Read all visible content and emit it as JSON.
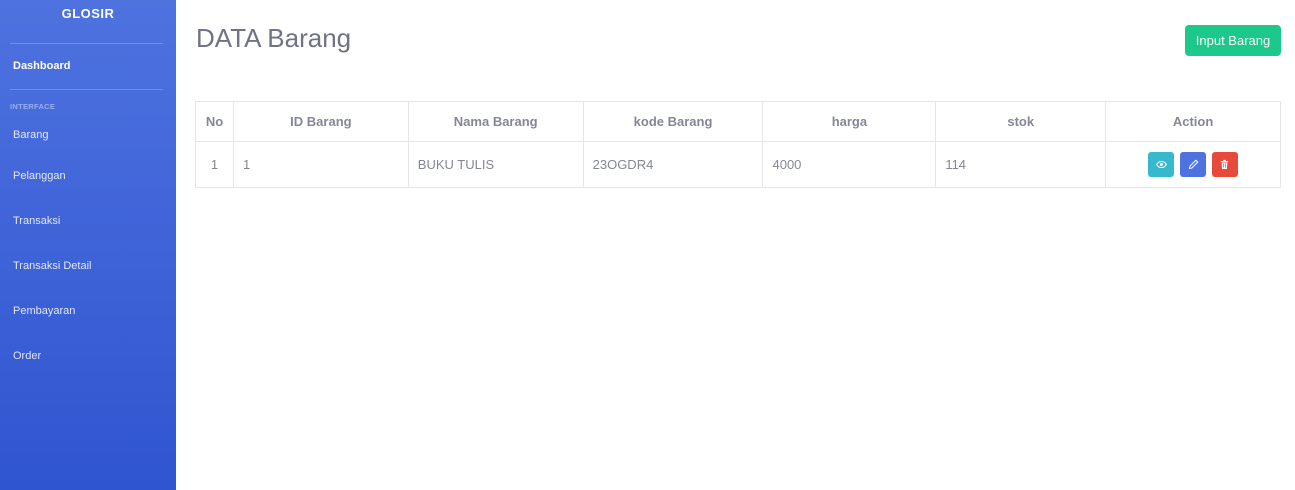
{
  "sidebar": {
    "brand": "GLOSIR",
    "dashboard": "Dashboard",
    "heading": "INTERFACE",
    "items": [
      {
        "label": "Barang"
      },
      {
        "label": "Pelanggan"
      },
      {
        "label": "Transaksi"
      },
      {
        "label": "Transaksi Detail"
      },
      {
        "label": "Pembayaran"
      },
      {
        "label": "Order"
      }
    ]
  },
  "main": {
    "title": "DATA Barang",
    "input_button": "Input Barang",
    "table": {
      "columns": [
        "No",
        "ID Barang",
        "Nama Barang",
        "kode Barang",
        "harga",
        "stok",
        "Action"
      ],
      "rows": [
        {
          "no": "1",
          "id": "1",
          "nama": "BUKU TULIS",
          "kode": "23OGDR4",
          "harga": "4000",
          "stok": "114"
        }
      ],
      "actions": {
        "view": "eye-icon",
        "edit": "pencil-icon",
        "delete": "trash-icon"
      }
    }
  },
  "colors": {
    "sidebar": "#4e73df",
    "success": "#1cc88a",
    "info": "#36b9cc",
    "primary": "#4e73df",
    "danger": "#e74a3b"
  }
}
